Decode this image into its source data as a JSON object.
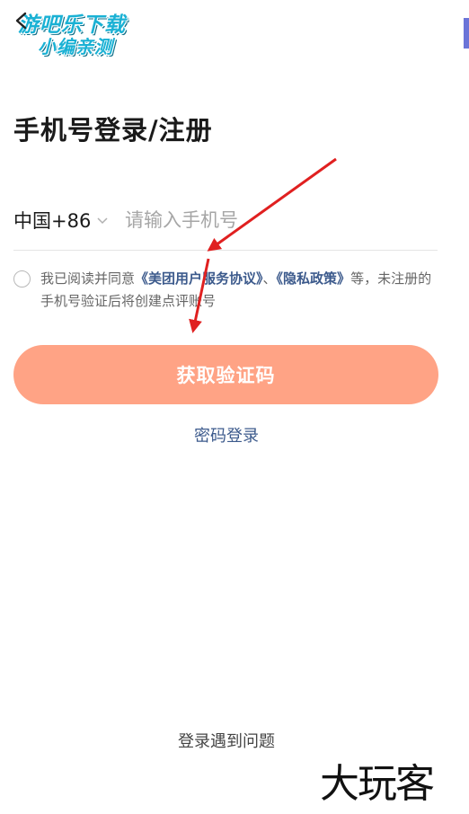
{
  "watermark_top": {
    "line1": "游吧乐下载",
    "line2": "小编亲测"
  },
  "page": {
    "title": "手机号登录/注册"
  },
  "phone": {
    "country_code": "中国+86",
    "input_value": "",
    "placeholder": "请输入手机号"
  },
  "agreement": {
    "prefix": "我已阅读并同意",
    "link1": "《美团用户服务协议》",
    "separator": "、",
    "link2": "《隐私政策》",
    "suffix": "等，未注册的手机号验证后将创建点评账号"
  },
  "buttons": {
    "get_code": "获取验证码",
    "password_login": "密码登录",
    "help": "登录遇到问题"
  },
  "watermark_bottom": "大玩客",
  "colors": {
    "primary_button": "#ffa385",
    "link": "#3c5a8c",
    "annotation_arrow": "#e02020"
  },
  "icons": [
    "back-arrow-icon",
    "chevron-down-icon",
    "radio-unchecked-icon"
  ]
}
